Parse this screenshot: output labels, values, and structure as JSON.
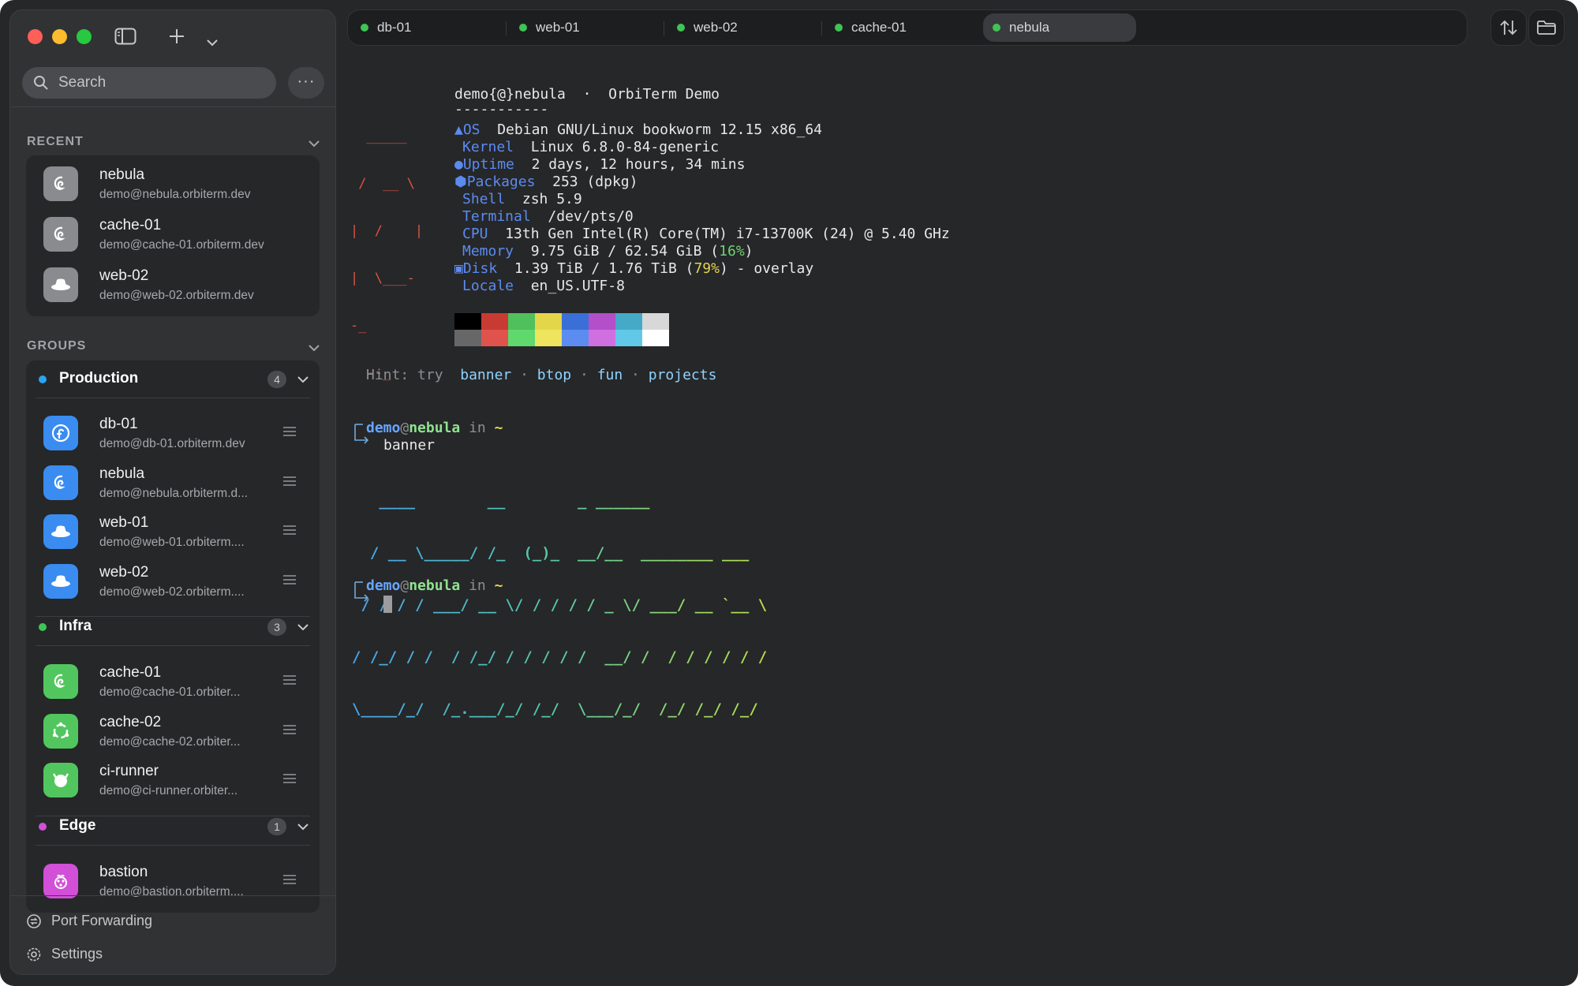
{
  "colors": {
    "window_bg": "#262729",
    "sidebar_bg": "#313234",
    "accent_blue": "#3a8cf0",
    "status_green": "#3fc454",
    "group_production": "#2aa4f4",
    "group_infra": "#3fc454",
    "group_edge": "#d24fd8"
  },
  "sidebar": {
    "search_placeholder": "Search",
    "more_label": "···",
    "recent_title": "RECENT",
    "groups_title": "GROUPS",
    "recent": [
      {
        "name": "nebula",
        "address": "demo@nebula.orbiterm.dev",
        "icon": "debian-icon"
      },
      {
        "name": "cache-01",
        "address": "demo@cache-01.orbiterm.dev",
        "icon": "debian-icon"
      },
      {
        "name": "web-02",
        "address": "demo@web-02.orbiterm.dev",
        "icon": "redhat-icon"
      }
    ],
    "groups": [
      {
        "name": "Production",
        "count": "4",
        "hosts": [
          {
            "name": "db-01",
            "address": "demo@db-01.orbiterm.dev",
            "icon": "fedora-icon"
          },
          {
            "name": "nebula",
            "address": "demo@nebula.orbiterm.d...",
            "icon": "debian-icon"
          },
          {
            "name": "web-01",
            "address": "demo@web-01.orbiterm....",
            "icon": "redhat-icon"
          },
          {
            "name": "web-02",
            "address": "demo@web-02.orbiterm....",
            "icon": "redhat-icon"
          }
        ]
      },
      {
        "name": "Infra",
        "count": "3",
        "hosts": [
          {
            "name": "cache-01",
            "address": "demo@cache-01.orbiter...",
            "icon": "debian-icon"
          },
          {
            "name": "cache-02",
            "address": "demo@cache-02.orbiter...",
            "icon": "ubuntu-icon"
          },
          {
            "name": "ci-runner",
            "address": "demo@ci-runner.orbiter...",
            "icon": "freebsd-icon"
          }
        ]
      },
      {
        "name": "Edge",
        "count": "1",
        "hosts": [
          {
            "name": "bastion",
            "address": "demo@bastion.orbiterm....",
            "icon": "raspberry-pi-icon"
          }
        ]
      }
    ],
    "footer": {
      "port_forwarding": "Port Forwarding",
      "settings": "Settings"
    }
  },
  "tabs": [
    {
      "label": "db-01",
      "active": false
    },
    {
      "label": "web-01",
      "active": false
    },
    {
      "label": "web-02",
      "active": false
    },
    {
      "label": "cache-01",
      "active": false
    },
    {
      "label": "nebula",
      "active": true
    }
  ],
  "terminal": {
    "header": {
      "user_host": "demo{@}nebula",
      "sep": "·",
      "title": "OrbiTerm Demo",
      "underline": "-----------"
    },
    "info": {
      "os_label": "OS",
      "os": "Debian GNU/Linux bookworm 12.15 x86_64",
      "kernel_label": "Kernel",
      "kernel": "Linux 6.8.0-84-generic",
      "uptime_label": "Uptime",
      "uptime": "2 days, 12 hours, 34 mins",
      "packages_label": "Packages",
      "packages": "253 (dpkg)",
      "shell_label": "Shell",
      "shell": "zsh 5.9",
      "terminal_label": "Terminal",
      "terminal": "/dev/pts/0",
      "cpu_label": "CPU",
      "cpu": "13th Gen Intel(R) Core(TM) i7-13700K (24) @ 5.40 GHz",
      "memory_label": "Memory",
      "memory": "9.75 GiB / 62.54 GiB (",
      "memory_pct": "16%",
      "memory_close": ")",
      "disk_label": "Disk",
      "disk": "1.39 TiB / 1.76 TiB (",
      "disk_pct": "79%",
      "disk_rest": ") - overlay",
      "locale_label": "Locale",
      "locale": "en_US.UTF-8"
    },
    "palette": [
      "#000000",
      "#c83b32",
      "#4fc05c",
      "#e4d64a",
      "#3b6fd8",
      "#b24fc9",
      "#45a9c8",
      "#d8d8d8",
      "#676767",
      "#e0534c",
      "#5fd86d",
      "#efe45e",
      "#5c8cf0",
      "#d06fe0",
      "#62c8e8",
      "#ffffff"
    ],
    "hint": {
      "prefix": "Hint: try",
      "cmd1": "banner",
      "dot": "·",
      "cmd2": "btop",
      "cmd3": "fun",
      "cmd4": "projects"
    },
    "prompt": {
      "user": "demo",
      "at": "@",
      "host": "nebula",
      "in": "in",
      "dir": "~"
    },
    "command": "banner",
    "ascii_logo": [
      "  _____",
      " /  __ \\",
      "|  /    |",
      "|  \\___-",
      "-_",
      "  --_"
    ],
    "banner_lines": [
      "   ____        __        _ ______",
      "  / __ \\_____/ /_  (_)_  __/__  ________ ___",
      " / / / / ___/ __ \\/ / / / / _ \\/ ___/ __ `__ \\",
      "/ /_/ / /  / /_/ / / / / /  __/ /  / / / / / /",
      "\\____/_/  /_.___/_/ /_/  \\___/_/  /_/ /_/ /_/"
    ]
  }
}
